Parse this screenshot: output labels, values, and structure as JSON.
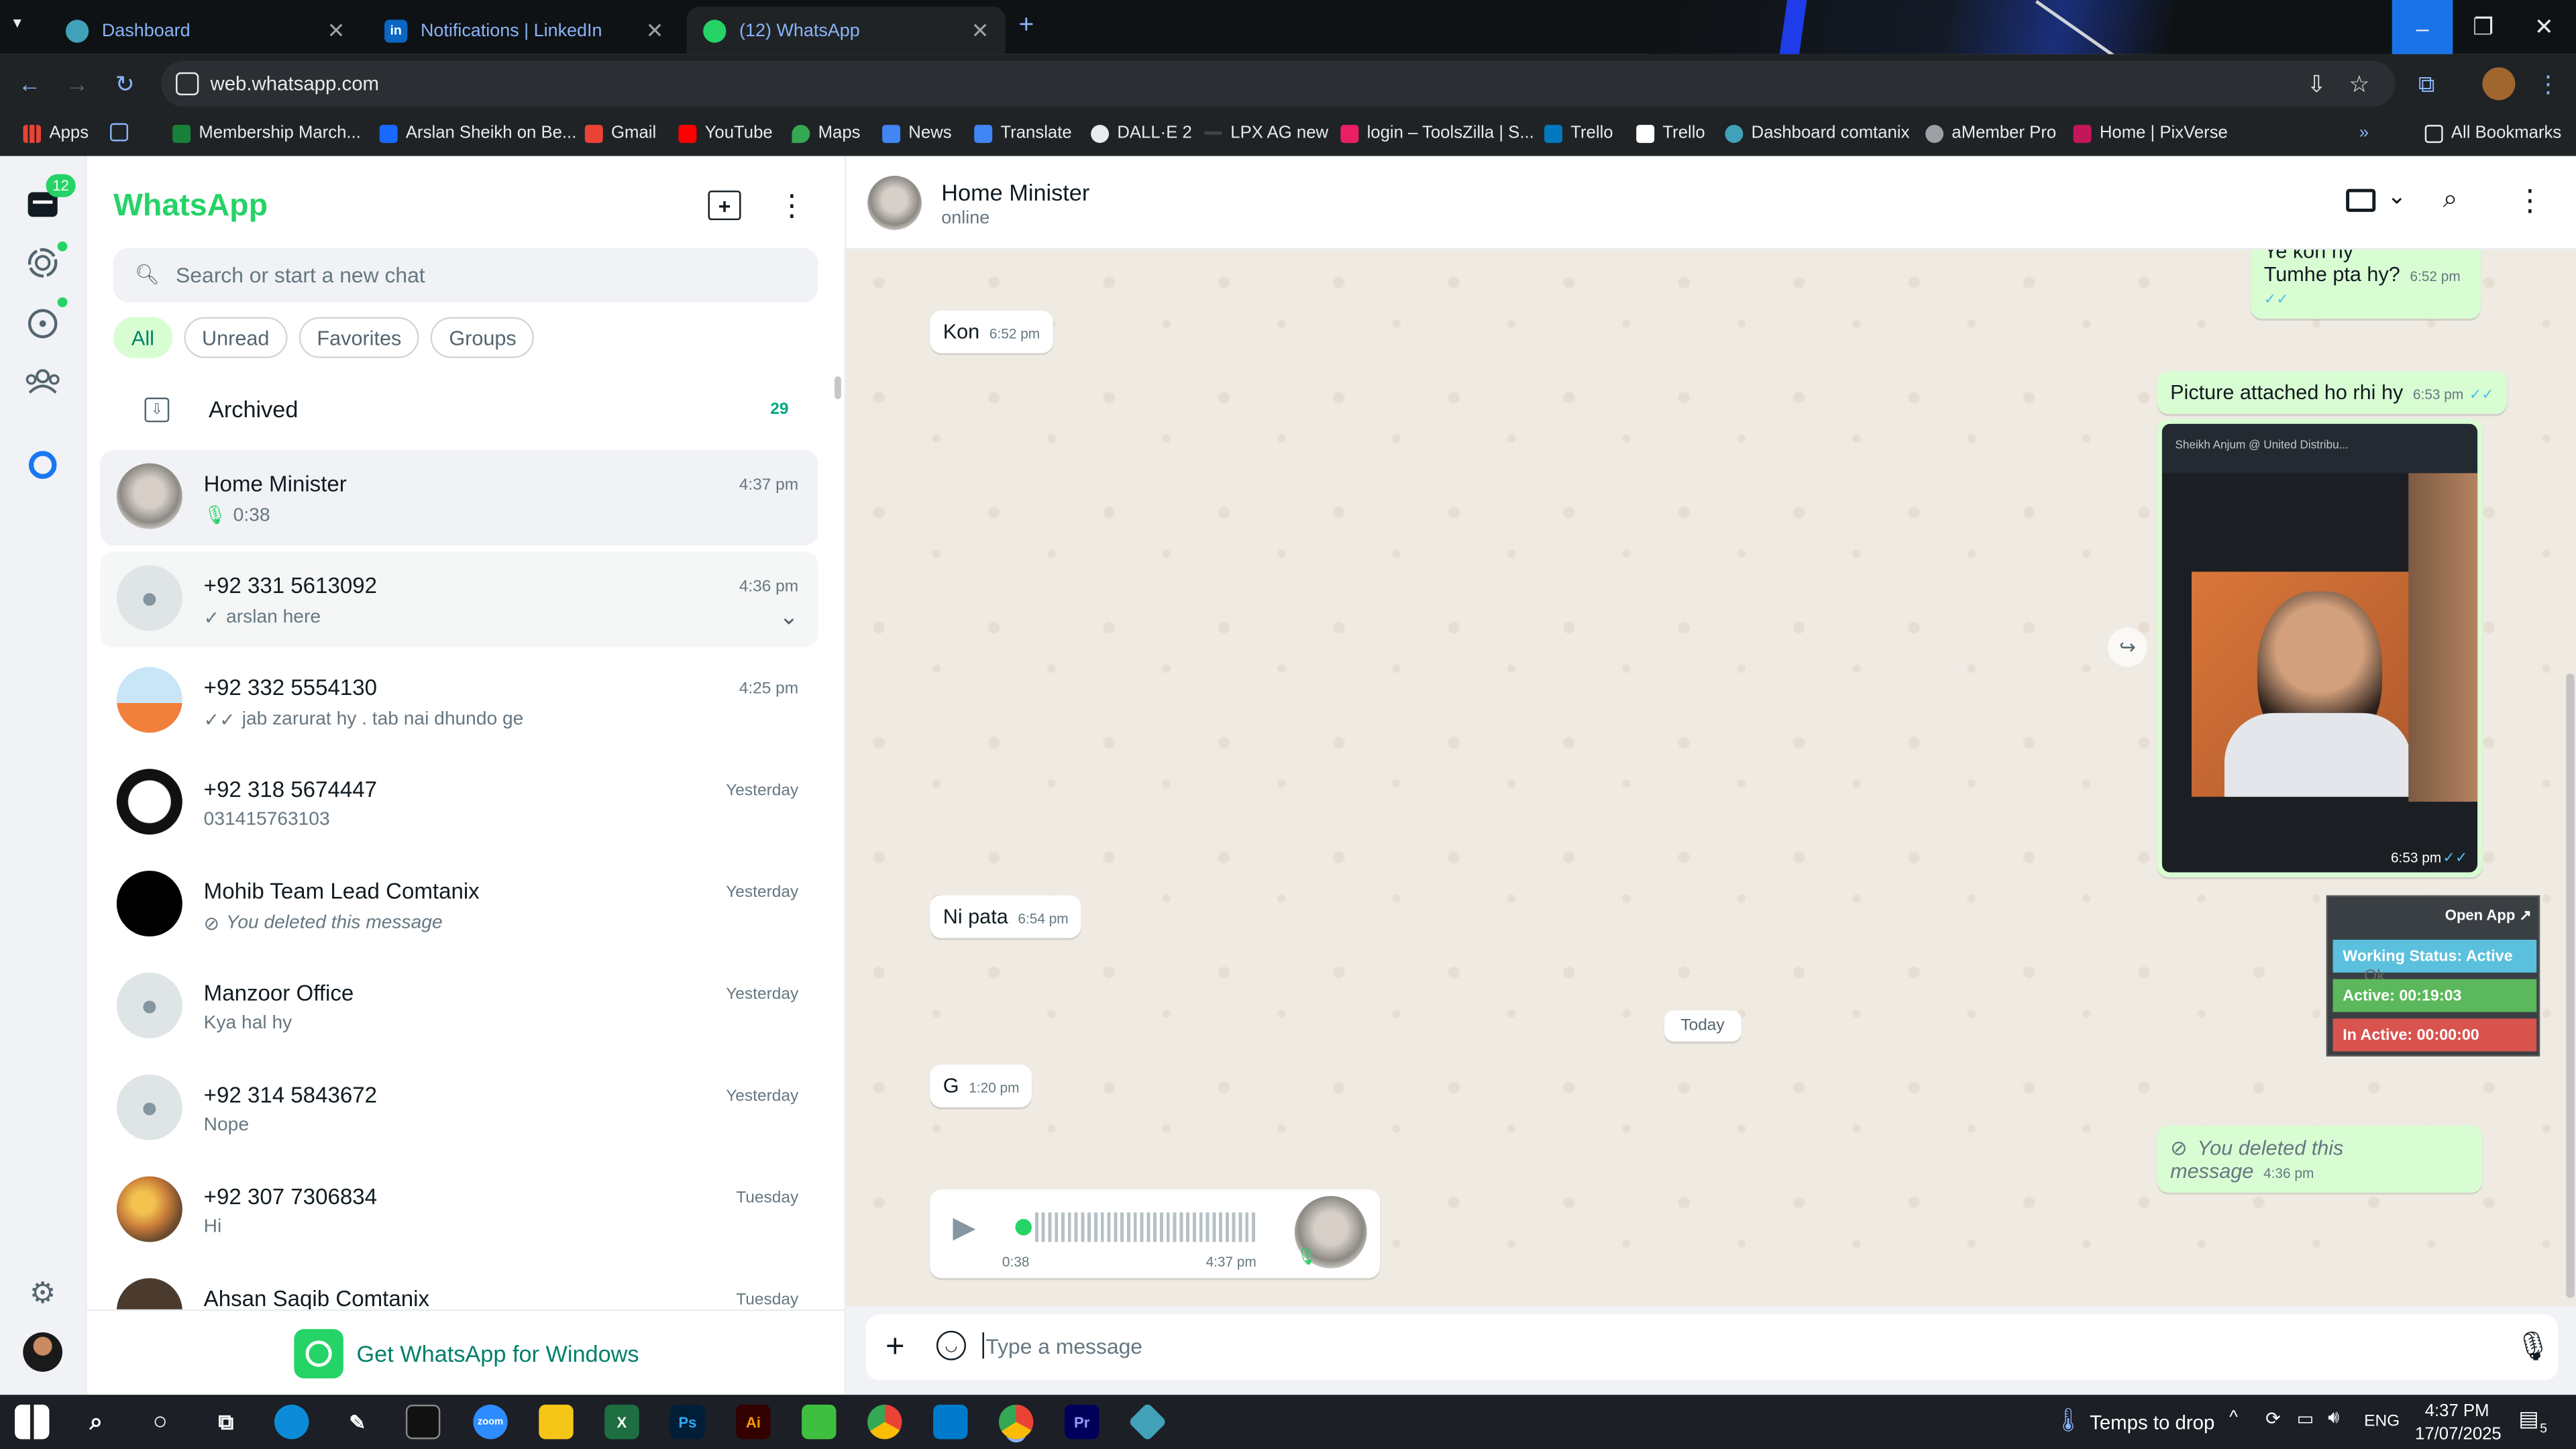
{
  "browser": {
    "tabs": [
      {
        "title": "Dashboard",
        "icon": "dashboard-tab-icon",
        "color": "#41a1b8"
      },
      {
        "title": "Notifications | LinkedIn",
        "icon": "linkedin-icon",
        "color": "#0a66c2"
      },
      {
        "title": "(12) WhatsApp",
        "icon": "whatsapp-icon",
        "color": "#25d366"
      }
    ],
    "url": "web.whatsapp.com",
    "bookmarks": [
      "Apps",
      "Membership March...",
      "Arslan Sheikh on Be...",
      "Gmail",
      "YouTube",
      "Maps",
      "News",
      "Translate",
      "DALL·E 2",
      "LPX AG new",
      "login – ToolsZilla | S...",
      "Trello",
      "Trello",
      "Dashboard comtanix",
      "aMember Pro",
      "Home | PixVerse"
    ],
    "all_bookmarks": "All Bookmarks"
  },
  "whatsapp": {
    "brand": "WhatsApp",
    "unread_badge": "12",
    "search_placeholder": "Search or start a new chat",
    "filters": [
      "All",
      "Unread",
      "Favorites",
      "Groups"
    ],
    "archived": {
      "label": "Archived",
      "count": "29"
    },
    "chats": [
      {
        "name": "Home Minister",
        "preview": "0:38",
        "time": "4:37 pm",
        "kind": "voice"
      },
      {
        "name": "+92 331 5613092",
        "preview": "arslan here",
        "time": "4:36 pm",
        "kind": "sent"
      },
      {
        "name": "+92 332 5554130",
        "preview": "jab zarurat hy . tab nai dhundo ge",
        "time": "4:25 pm",
        "kind": "read"
      },
      {
        "name": "+92 318 5674447",
        "preview": "031415763103",
        "time": "Yesterday",
        "kind": "text"
      },
      {
        "name": "Mohib Team Lead Comtanix",
        "preview": "You deleted this message",
        "time": "Yesterday",
        "kind": "deleted"
      },
      {
        "name": "Manzoor Office",
        "preview": "Kya hal hy",
        "time": "Yesterday",
        "kind": "text"
      },
      {
        "name": "+92 314 5843672",
        "preview": "Nope",
        "time": "Yesterday",
        "kind": "text"
      },
      {
        "name": "+92 307 7306834",
        "preview": "Hi",
        "time": "Tuesday",
        "kind": "text"
      },
      {
        "name": "Ahsan Saqib Comtanix",
        "preview": "",
        "time": "Tuesday",
        "kind": "text"
      }
    ],
    "get_app": "Get WhatsApp for Windows",
    "conversation": {
      "name": "Home Minister",
      "status": "online",
      "messages": [
        {
          "dir": "out",
          "text": "Ye kon hy",
          "text2": "Tumhe pta hy?",
          "time": "6:52 pm"
        },
        {
          "dir": "in",
          "text": "Kon",
          "time": "6:52 pm"
        },
        {
          "dir": "out",
          "text": "Picture attached ho rhi hy",
          "time": "6:53 pm"
        },
        {
          "dir": "out",
          "image_caption": "Sheikh Anjum @ United Distribu...",
          "time": "6:53 pm"
        },
        {
          "dir": "in",
          "text": "Ni pata",
          "time": "6:54 pm"
        },
        {
          "dir": "in",
          "text": "G",
          "time": "1:20 pm"
        },
        {
          "dir": "out",
          "text": "You deleted this message",
          "time": "4:36 pm"
        },
        {
          "dir": "in",
          "voice_duration": "0:38",
          "time": "4:37 pm"
        }
      ],
      "day_separator": "Today",
      "composer_placeholder": "Type a message"
    }
  },
  "overlay": {
    "open_app": "Open App ↗",
    "working_status": "Working Status: Active",
    "active": "Active: 00:19:03",
    "inactive": "In Active: 00:00:00",
    "ghost_text": "Ok"
  },
  "taskbar": {
    "weather": "Temps to drop",
    "lang": "ENG",
    "time": "4:37 PM",
    "date": "17/07/2025",
    "notif_count": "5"
  }
}
